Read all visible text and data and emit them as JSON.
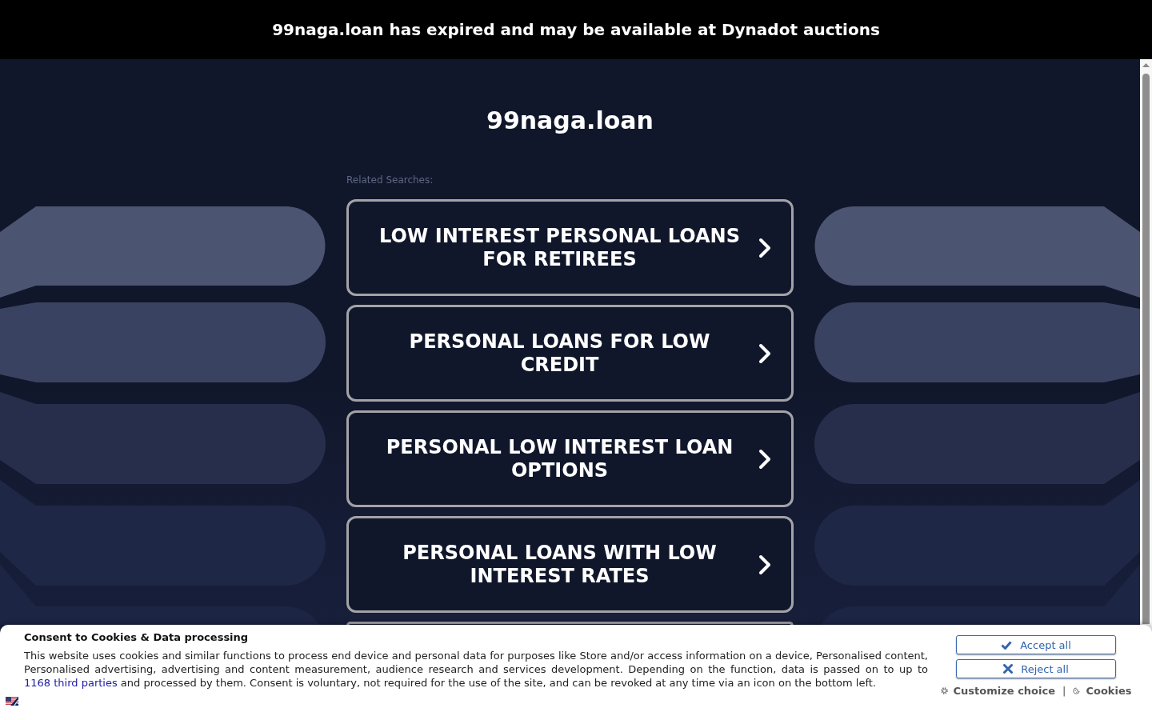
{
  "expiry_banner": {
    "text": "99naga.loan has expired and may be available at Dynadot auctions"
  },
  "domain_title": "99naga.loan",
  "related_searches": {
    "label": "Related Searches:",
    "items": [
      {
        "label": "LOW INTEREST PERSONAL LOANS FOR RETIREES"
      },
      {
        "label": "PERSONAL LOANS FOR LOW CREDIT"
      },
      {
        "label": "PERSONAL LOW INTEREST LOAN OPTIONS"
      },
      {
        "label": "PERSONAL LOANS WITH LOW INTEREST RATES"
      }
    ]
  },
  "cookie_consent": {
    "title": "Consent to Cookies & Data processing",
    "text_before": "This website uses cookies and similar functions to process end device and personal data for purposes like Store and/or access information on a device, Personalised content, Personalised advertising, advertising and content measurement, audience research and services development. Depending on the function, data is passed on to up to",
    "link": "1168 third parties",
    "text_after": "and processed by them. Consent is voluntary, not required for the use of the site, and can be revoked at any time via an icon on the bottom left.",
    "buttons": [
      {
        "kind": "accept",
        "label": "Accept all"
      },
      {
        "kind": "reject",
        "label": "Reject all"
      }
    ],
    "links": [
      {
        "kind": "customize",
        "label": "Customize choice"
      },
      {
        "kind": "cookies",
        "label": "Cookies"
      }
    ],
    "separator": "|"
  }
}
